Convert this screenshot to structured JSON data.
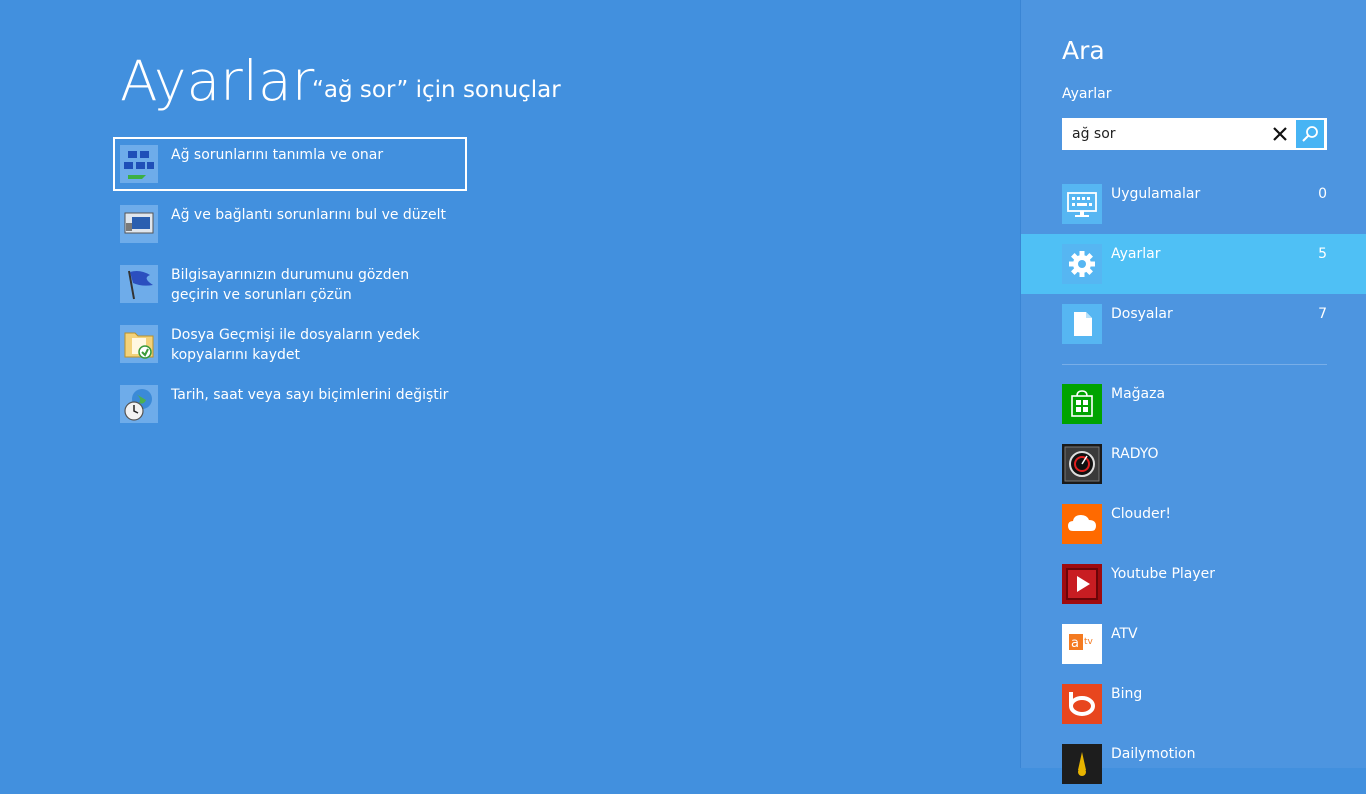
{
  "main": {
    "title": "Ayarlar",
    "query_heading": "“ağ sor” için sonuçlar",
    "results": [
      {
        "label": "Ağ sorunlarını tanımla ve onar"
      },
      {
        "label": "Ağ ve bağlantı sorunlarını bul ve düzelt"
      },
      {
        "label": "Bilgisayarınızın durumunu gözden geçirin ve sorunları çözün"
      },
      {
        "label": "Dosya Geçmişi ile dosyaların yedek kopyalarını kaydet"
      },
      {
        "label": "Tarih, saat veya sayı biçimlerini değiştir"
      }
    ]
  },
  "pane": {
    "title": "Ara",
    "scope": "Ayarlar",
    "search_value": "ağ sor",
    "categories": [
      {
        "label": "Uygulamalar",
        "count": "0",
        "icon": "monitor-keyboard-icon"
      },
      {
        "label": "Ayarlar",
        "count": "5",
        "icon": "gear-icon"
      },
      {
        "label": "Dosyalar",
        "count": "7",
        "icon": "document-icon"
      }
    ],
    "apps": [
      {
        "label": "Mağaza",
        "icon": "store-icon",
        "color": "#00a300"
      },
      {
        "label": "RADYO",
        "icon": "radio-icon",
        "color": "#1a1a1a"
      },
      {
        "label": "Clouder!",
        "icon": "cloud-icon",
        "color": "#ff6a00"
      },
      {
        "label": "Youtube Player",
        "icon": "play-icon",
        "color": "#9e0b0f"
      },
      {
        "label": "ATV",
        "icon": "atv-logo-icon",
        "color": "#ffffff"
      },
      {
        "label": "Bing",
        "icon": "bing-icon",
        "color": "#e8461e"
      },
      {
        "label": "Dailymotion",
        "icon": "dailymotion-icon",
        "color": "#1d1d1d"
      }
    ]
  }
}
